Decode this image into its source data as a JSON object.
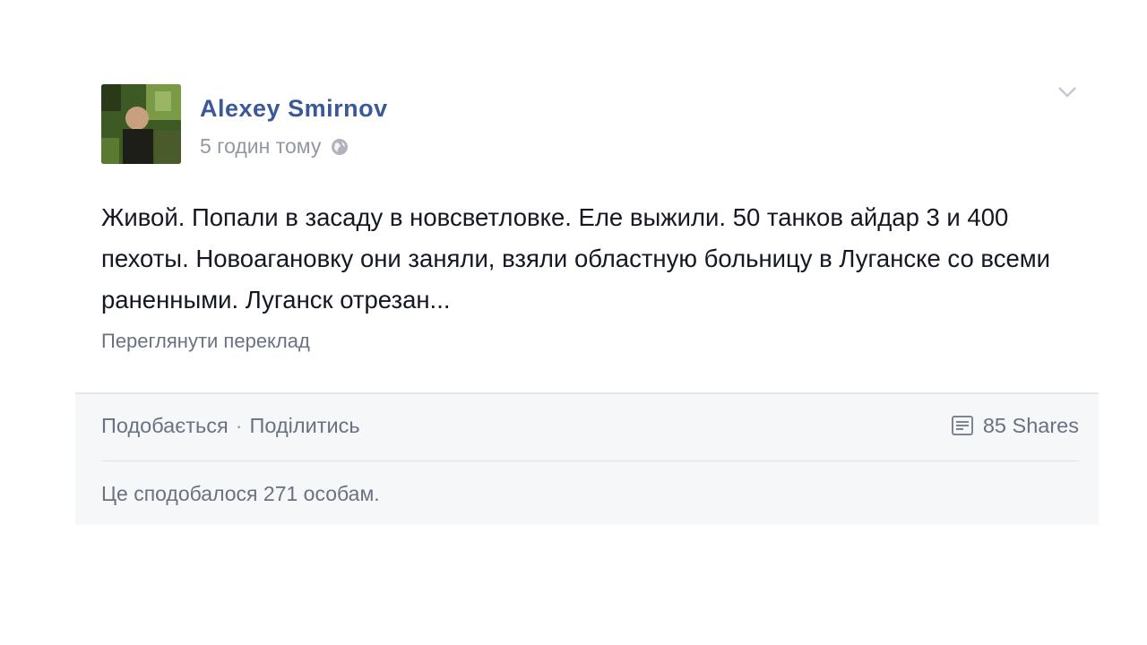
{
  "post": {
    "author": "Alexey Smirnov",
    "timestamp": "5 годин тому",
    "privacy_icon": "globe-icon",
    "menu_icon": "chevron-down-icon",
    "text": "Живой. Попали в засаду в новсветловке. Еле выжили. 50 танков айдар 3 и 400 пехоты. Новоагановку они заняли, взяли областную больницу в Луганске со всеми раненными. Луганск отрезан...",
    "translate_link": "Переглянути переклад"
  },
  "footer": {
    "like_label": "Подобається",
    "separator": "·",
    "share_label": "Поділитись",
    "shares_icon": "shares-icon",
    "shares_count": "85 Shares",
    "likes_summary": "Це сподобалося 271 особам."
  },
  "colors": {
    "author_link": "#3b5998",
    "meta_text": "#9197a3",
    "body_text": "#141823",
    "footer_bg": "#f6f7f8"
  }
}
